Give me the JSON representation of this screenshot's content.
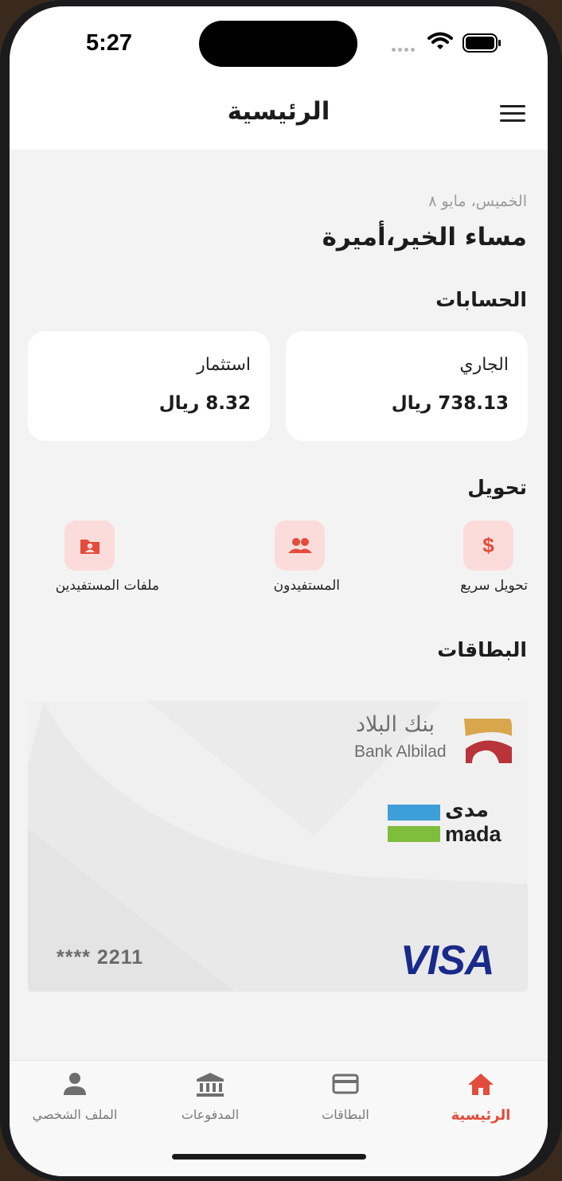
{
  "status_bar": {
    "time": "5:27"
  },
  "header": {
    "title": "الرئيسية"
  },
  "greeting": {
    "date": "الخميس، مايو ٨",
    "text": "مساء الخير،أميرة"
  },
  "accounts": {
    "title": "الحسابات",
    "items": [
      {
        "name": "الجاري",
        "balance": "738.13 ريال"
      },
      {
        "name": "استثمار",
        "balance": "8.32 ريال"
      }
    ]
  },
  "transfer": {
    "title": "تحويل",
    "actions": [
      {
        "label": "تحويل سريع",
        "icon": "dollar-icon"
      },
      {
        "label": "المستفيدون",
        "icon": "people-icon"
      },
      {
        "label": "ملفات المستفيدين",
        "icon": "contact-folder-icon"
      }
    ]
  },
  "cards": {
    "title": "البطاقات",
    "card": {
      "bank_name_ar": "بنك البلاد",
      "bank_name_en": "Bank Albilad",
      "network_ar": "مدى",
      "network_en": "mada",
      "brand": "VISA",
      "number_masked": "**** 2211"
    }
  },
  "tabbar": {
    "items": [
      {
        "label": "الرئيسية",
        "icon": "home-icon",
        "active": true
      },
      {
        "label": "البطاقات",
        "icon": "card-icon",
        "active": false
      },
      {
        "label": "المدفوعات",
        "icon": "bank-icon",
        "active": false
      },
      {
        "label": "الملف الشخصي",
        "icon": "person-icon",
        "active": false
      }
    ]
  },
  "colors": {
    "accent": "#e34c3c",
    "accent_soft": "#fbdcda",
    "background": "#f3f3f3"
  }
}
